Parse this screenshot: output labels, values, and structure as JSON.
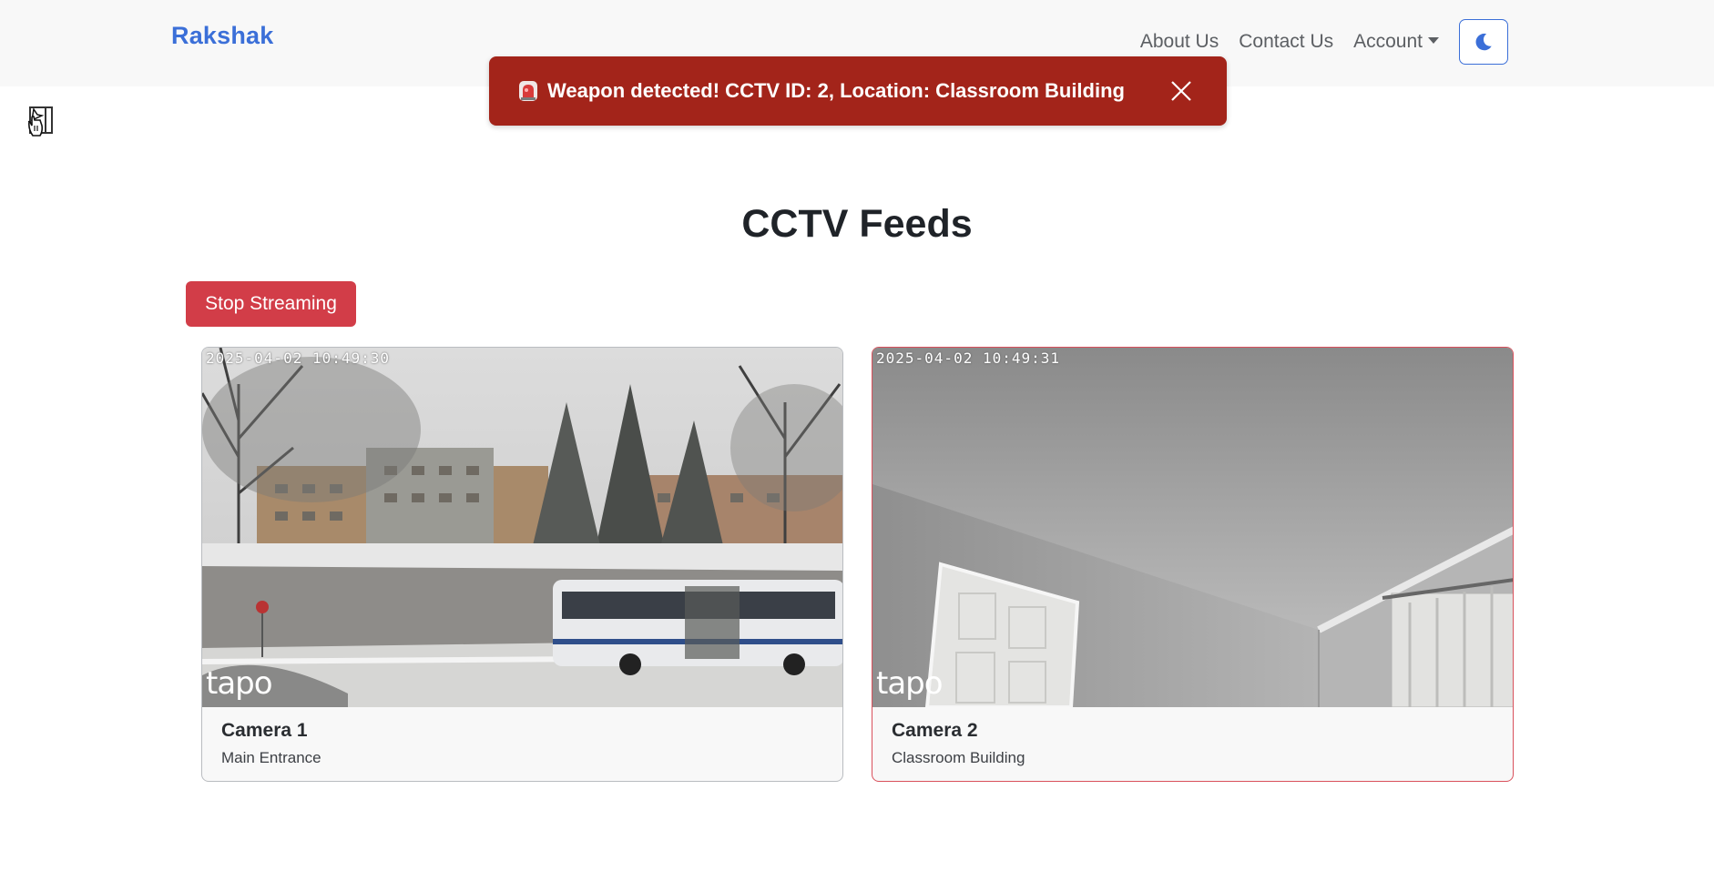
{
  "nav": {
    "brand": "Rakshak",
    "links": {
      "about": "About Us",
      "contact": "Contact Us",
      "account": "Account"
    },
    "theme_icon": "moon-icon"
  },
  "sidebar": {
    "toggle_icon": "sidebar-toggle-icon"
  },
  "toast": {
    "icon": "siren-icon",
    "message": "Weapon detected! CCTV ID: 2, Location: Classroom Building",
    "close_icon": "close-icon",
    "color": "#a3241a"
  },
  "page": {
    "title": "CCTV Feeds",
    "stop_label": "Stop Streaming"
  },
  "cameras": [
    {
      "title": "Camera 1",
      "location": "Main Entrance",
      "timestamp": "2025-04-02 10:49:30",
      "watermark": "tapo",
      "alert": false
    },
    {
      "title": "Camera 2",
      "location": "Classroom Building",
      "timestamp": "2025-04-02 10:49:31",
      "watermark": "tapo",
      "alert": true
    }
  ],
  "colors": {
    "accent": "#3b6fd8",
    "danger": "#d23d48"
  }
}
